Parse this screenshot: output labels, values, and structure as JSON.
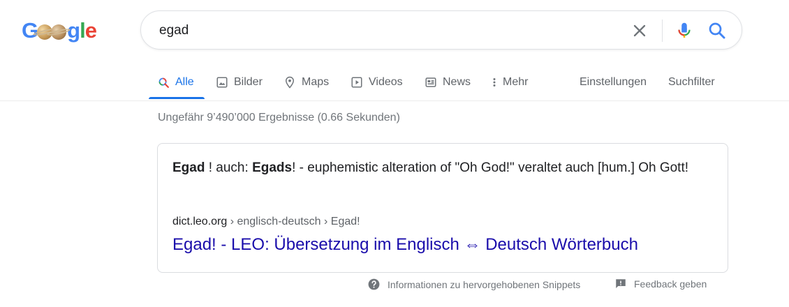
{
  "logo": {
    "g1": "G",
    "g2": "g",
    "l": "l",
    "e": "e"
  },
  "search": {
    "query": "egad"
  },
  "tabs": [
    {
      "label": "Alle",
      "icon": "search-icon"
    },
    {
      "label": "Bilder",
      "icon": "image-icon"
    },
    {
      "label": "Maps",
      "icon": "map-pin-icon"
    },
    {
      "label": "Videos",
      "icon": "video-play-icon"
    },
    {
      "label": "News",
      "icon": "news-icon"
    },
    {
      "label": "Mehr",
      "icon": "more-vertical-icon"
    }
  ],
  "tools": {
    "settings": "Einstellungen",
    "filter": "Suchfilter"
  },
  "stats": "Ungefähr 9’490’000 Ergebnisse (0.66 Sekunden)",
  "snippet": {
    "term1": "Egad",
    "mid1": " ! auch: ",
    "term2": "Egads",
    "rest": "! - euphemistic alteration of \"Oh God!\" veraltet auch [hum.] Oh Gott!",
    "cite_domain": "dict.leo.org",
    "cite_trail": " › englisch-deutsch › Egad!",
    "link_title": "Egad! - LEO: Übersetzung im Englisch ⇔ Deutsch Wörterbuch"
  },
  "footer": {
    "info": "Informationen zu hervorgehobenen Snippets",
    "feedback": "Feedback geben"
  },
  "colors": {
    "accent": "#1a73e8",
    "link": "#1a0dab",
    "muted": "#70757a"
  }
}
